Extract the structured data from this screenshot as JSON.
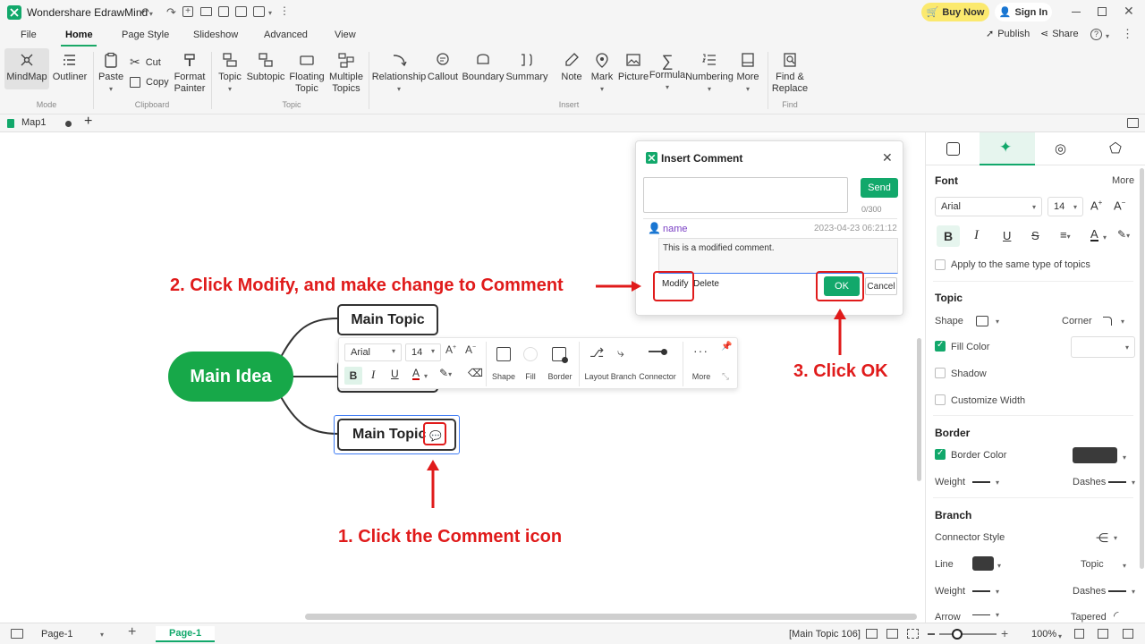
{
  "app": {
    "title": "Wondershare EdrawMind",
    "buy_now": "Buy Now",
    "sign_in": "Sign In",
    "publish": "Publish",
    "share": "Share",
    "help": "?"
  },
  "menu_tabs": [
    "File",
    "Home",
    "Page Style",
    "Slideshow",
    "Advanced",
    "View"
  ],
  "ribbon": {
    "mode": {
      "mindmap": "MindMap",
      "outliner": "Outliner",
      "group": "Mode"
    },
    "clipboard": {
      "paste": "Paste",
      "cut": "Cut",
      "copy": "Copy",
      "format_painter_1": "Format",
      "format_painter_2": "Painter",
      "group": "Clipboard"
    },
    "topic": {
      "topic": "Topic",
      "subtopic": "Subtopic",
      "floating_1": "Floating",
      "floating_2": "Topic",
      "multiple_1": "Multiple",
      "multiple_2": "Topics",
      "group": "Topic"
    },
    "insert": {
      "relationship": "Relationship",
      "callout": "Callout",
      "boundary": "Boundary",
      "summary": "Summary",
      "note": "Note",
      "mark": "Mark",
      "picture": "Picture",
      "formula": "Formula",
      "numbering": "Numbering",
      "more": "More",
      "group": "Insert"
    },
    "find": {
      "find_1": "Find &",
      "find_2": "Replace",
      "group": "Find"
    }
  },
  "doc_tab": {
    "name": "Map1"
  },
  "canvas": {
    "main_idea": "Main Idea",
    "topic_top": "Main Topic",
    "topic_bottom": "Main Topic"
  },
  "floating_toolbar": {
    "font": "Arial",
    "size": "14",
    "items": [
      "Shape",
      "Fill",
      "Border",
      "Layout",
      "Branch",
      "Connector",
      "More"
    ]
  },
  "comment_dialog": {
    "title": "Insert Comment",
    "send": "Send",
    "counter": "0/300",
    "user": "name",
    "timestamp": "2023-04-23 06:21:12",
    "comment_text": "This is a modified comment.",
    "modify": "Modify",
    "delete": "Delete",
    "ok": "OK",
    "cancel": "Cancel"
  },
  "annotations": {
    "step1": "1. Click the Comment icon",
    "step2": "2. Click Modify, and make change to Comment",
    "step3": "3. Click OK"
  },
  "right_panel": {
    "font_title": "Font",
    "more": "More",
    "font": "Arial",
    "size": "14",
    "apply_same": "Apply to the same type of topics",
    "topic_title": "Topic",
    "shape": "Shape",
    "corner": "Corner",
    "fill_color": "Fill Color",
    "shadow": "Shadow",
    "customize_width": "Customize Width",
    "border_title": "Border",
    "border_color": "Border Color",
    "weight": "Weight",
    "dashes": "Dashes",
    "branch_title": "Branch",
    "connector_style": "Connector Style",
    "line": "Line",
    "topic": "Topic",
    "weight2": "Weight",
    "dashes2": "Dashes",
    "arrow": "Arrow",
    "tapered": "Tapered"
  },
  "status_bar": {
    "page_select": "Page-1",
    "page_tab": "Page-1",
    "selection": "[Main Topic 106]",
    "zoom": "100%"
  },
  "colors": {
    "accent": "#12a86b",
    "main_idea": "#17a849",
    "annotation": "#e01b1b"
  }
}
